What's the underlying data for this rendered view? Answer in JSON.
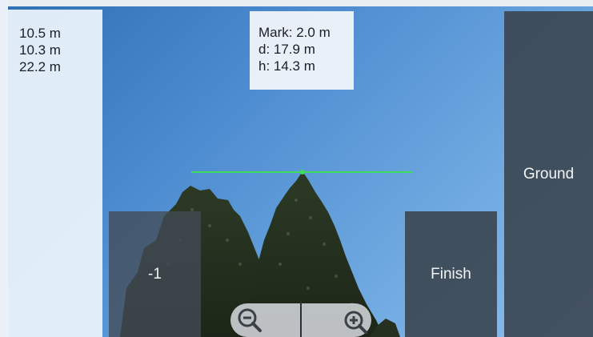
{
  "measurements": {
    "distances": [
      "10.5 m",
      "10.3 m",
      "22.2 m"
    ]
  },
  "info": {
    "mark": "Mark: 2.0 m",
    "distance": "d: 17.9 m",
    "height": "h: 14.3 m"
  },
  "controls": {
    "decrement_label": "-1",
    "finish_label": "Finish",
    "ground_label": "Ground"
  },
  "zoom": {
    "out_icon": "zoom-out-icon",
    "in_icon": "zoom-in-icon"
  },
  "colors": {
    "reticle": "#3ddc5a",
    "button_bg": "#3c4854",
    "panel_bg": "#e9f2fa"
  }
}
